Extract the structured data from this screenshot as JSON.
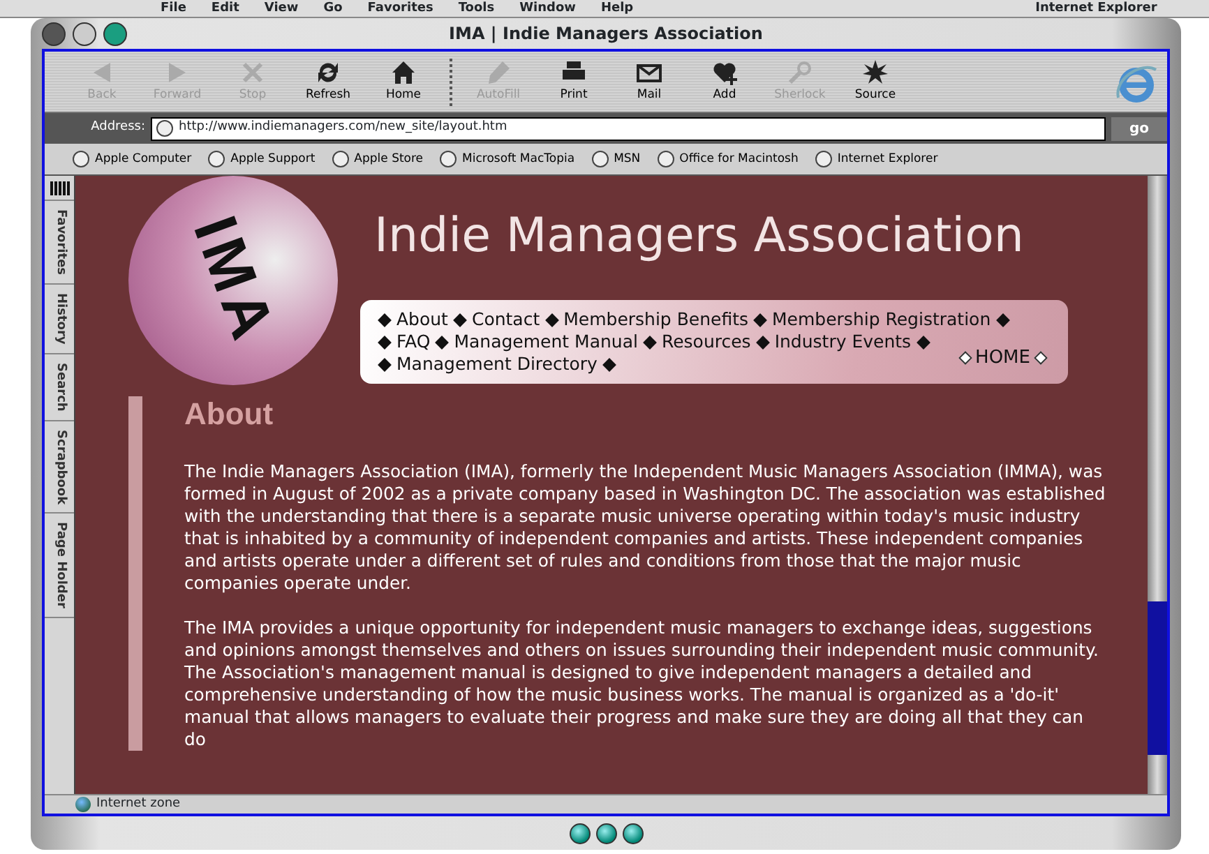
{
  "menu_bar": {
    "items": [
      "File",
      "Edit",
      "View",
      "Go",
      "Favorites",
      "Tools",
      "Window",
      "Help"
    ],
    "app": "Internet Explorer"
  },
  "window": {
    "title": "IMA | Indie Managers Association"
  },
  "toolbar": [
    {
      "kind": "back",
      "label": "Back",
      "disabled": true
    },
    {
      "kind": "forward",
      "label": "Forward",
      "disabled": true
    },
    {
      "kind": "stop",
      "label": "Stop",
      "disabled": true
    },
    {
      "kind": "refresh",
      "label": "Refresh",
      "disabled": false
    },
    {
      "kind": "home",
      "label": "Home",
      "disabled": false
    },
    {
      "kind": "autofill",
      "label": "AutoFill",
      "disabled": true
    },
    {
      "kind": "print",
      "label": "Print",
      "disabled": false
    },
    {
      "kind": "mail",
      "label": "Mail",
      "disabled": false
    },
    {
      "kind": "add",
      "label": "Add",
      "disabled": false
    },
    {
      "kind": "sherlock",
      "label": "Sherlock",
      "disabled": true
    },
    {
      "kind": "source",
      "label": "Source",
      "disabled": false
    }
  ],
  "address": {
    "label": "Address:",
    "url": "http://www.indiemanagers.com/new_site/layout.htm",
    "go": "go"
  },
  "favorites": [
    "Apple Computer",
    "Apple Support",
    "Apple Store",
    "Microsoft MacTopia",
    "MSN",
    "Office for Macintosh",
    "Internet Explorer"
  ],
  "explorer_tabs": [
    "Favorites",
    "History",
    "Search",
    "Scrapbook",
    "Page Holder"
  ],
  "site": {
    "logo_text": "IMA",
    "title": "Indie Managers Association",
    "nav_rows": [
      [
        "About",
        "Contact",
        "Membership Benefits",
        "Membership Registration"
      ],
      [
        "FAQ",
        "Management Manual",
        "Resources",
        "Industry Events"
      ],
      [
        "Management Directory"
      ]
    ],
    "home": "HOME",
    "heading": "About",
    "paragraphs": [
      "The Indie Managers Association (IMA), formerly the Independent Music Managers Association (IMMA), was formed in August of 2002 as a private company based in Washington DC. The association was established with the understanding that there is a separate music universe operating within today's music industry that is inhabited by a community of independent companies and artists. These independent companies and artists operate under a different set of rules and conditions from those that the major music companies operate under.",
      "The IMA provides a unique opportunity for independent music managers to exchange ideas, suggestions and opinions amongst themselves and others on issues surrounding their independent music community. The Association's management manual is designed to give independent managers a detailed and comprehensive understanding of how the music business works. The manual is organized as a 'do-it' manual that allows managers to evaluate their progress and make sure they are doing all that they can do"
    ]
  },
  "status_bar": {
    "zone": "Internet zone"
  }
}
